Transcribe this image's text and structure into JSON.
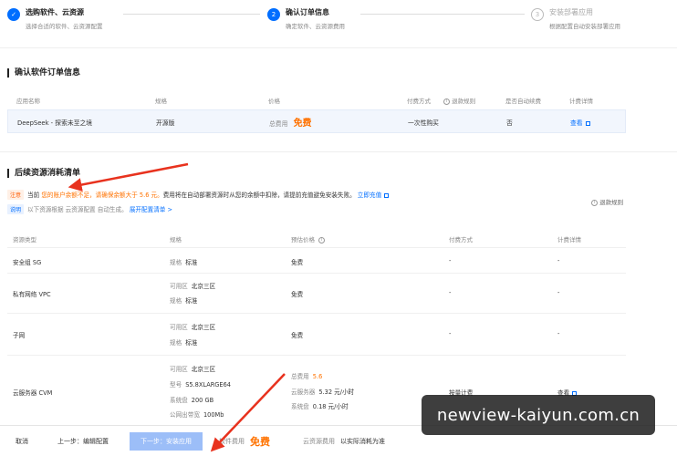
{
  "steps": [
    {
      "index": "✓",
      "title": "选购软件、云资源",
      "desc": "选择合适的软件、云资源配置",
      "state": "done"
    },
    {
      "index": "2",
      "title": "确认订单信息",
      "desc": "确定软件、云资源费用",
      "state": "active"
    },
    {
      "index": "3",
      "title": "安装部署应用",
      "desc": "根据配置自动安装部署应用",
      "state": "pending"
    }
  ],
  "order": {
    "section_title": "确认软件订单信息",
    "headers": {
      "name": "应用名称",
      "spec": "规格",
      "price": "价格",
      "pay": "付费方式",
      "refund": "退款规则",
      "auto": "是否自动续费",
      "detail": "计费详情"
    },
    "row": {
      "name": "DeepSeek - 探索未至之境",
      "spec": "开源版",
      "price_label": "总费用",
      "price_value": "免费",
      "pay": "一次性购买",
      "auto": "否",
      "detail": "查看"
    }
  },
  "resources": {
    "section_title": "后续资源消耗清单",
    "notice_tag": "注意",
    "notice_prefix": "当前",
    "notice_warn": "您的账户余额不足，请确保余额大于 5.6 元。",
    "notice_rest": "费用将在自动部署资源时从您的余额中扣除，请提前充值避免安装失败。",
    "notice_link": "立即充值",
    "info_tag": "说明",
    "info_text": "以下资源根据 云资源配置 自动生成。",
    "info_link": "展开配置清单 >",
    "refund_rule": "退款规则",
    "headers": {
      "type": "资源类型",
      "spec": "规格",
      "price": "预估价格",
      "pay": "付费方式",
      "detail": "计费详情"
    },
    "rows": [
      {
        "type": "安全组 SG",
        "specs": [
          {
            "k": "规格",
            "v": "标准"
          }
        ],
        "price": "免费",
        "pay": "-",
        "detail": "-"
      },
      {
        "type": "私有网络 VPC",
        "specs": [
          {
            "k": "可用区",
            "v": "北京三区"
          },
          {
            "k": "规格",
            "v": "标准"
          }
        ],
        "price": "免费",
        "pay": "-",
        "detail": "-"
      },
      {
        "type": "子网",
        "specs": [
          {
            "k": "可用区",
            "v": "北京三区"
          },
          {
            "k": "规格",
            "v": "标准"
          }
        ],
        "price": "免费",
        "pay": "-",
        "detail": "-"
      },
      {
        "type": "云服务器 CVM",
        "specs": [
          {
            "k": "可用区",
            "v": "北京三区"
          },
          {
            "k": "型号",
            "v": "S5.8XLARGE64"
          },
          {
            "k": "系统盘",
            "v": "200 GB"
          },
          {
            "k": "公网出带宽",
            "v": "100Mb"
          }
        ],
        "price_total_label": "总费用",
        "price_total": "5.6",
        "price_lines": [
          {
            "k": "云服务器",
            "v": "5.32 元/小时"
          },
          {
            "k": "系统盘",
            "v": "0.18 元/小时"
          }
        ],
        "pay": "按量计费",
        "detail": "查看"
      }
    ]
  },
  "footer": {
    "cancel": "取消",
    "prev": "上一步：编辑配置",
    "next": "下一步：安装应用",
    "software_fee_label": "软件费用",
    "software_fee_value": "免费",
    "cloud_fee_label": "云资源费用",
    "cloud_fee_value": "以实际消耗为准"
  },
  "watermark": "newview-kaiyun.com.cn",
  "colors": {
    "accent": "#006eff",
    "warn": "#ff7200",
    "annotation_arrow": "#e8321e"
  }
}
